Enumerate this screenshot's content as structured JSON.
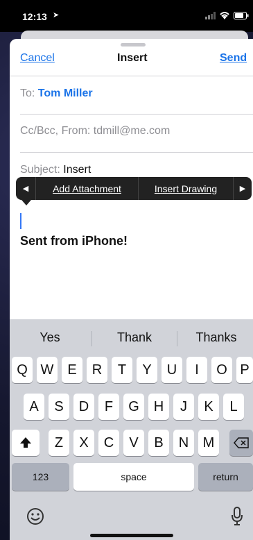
{
  "status_bar": {
    "time": "12:13"
  },
  "nav": {
    "cancel": "Cancel",
    "title": "Insert",
    "send": "Send"
  },
  "fields": {
    "to_label": "To:",
    "to_value": "Tom Miller",
    "cc_label": "Cc/Bcc, From:",
    "from_value": "tdmill@me.com",
    "subject_label": "Subject:",
    "subject_value": "Insert"
  },
  "callout_menu": {
    "items": [
      "Add Attachment",
      "Insert Drawing"
    ],
    "prev_arrow": "◀",
    "next_arrow": "▶"
  },
  "body": {
    "signature": "Sent from iPhone!"
  },
  "keyboard": {
    "suggestions": [
      "Yes",
      "Thank",
      "Thanks"
    ],
    "row1": [
      "Q",
      "W",
      "E",
      "R",
      "T",
      "Y",
      "U",
      "I",
      "O",
      "P"
    ],
    "row2": [
      "A",
      "S",
      "D",
      "F",
      "G",
      "H",
      "J",
      "K",
      "L"
    ],
    "row3": [
      "Z",
      "X",
      "C",
      "V",
      "B",
      "N",
      "M"
    ],
    "numbers_label": "123",
    "space_label": "space",
    "return_label": "return",
    "icons": [
      "shift-icon",
      "delete-icon",
      "emoji-icon",
      "microphone-icon"
    ]
  },
  "colors": {
    "accent": "#1a73e8",
    "callout_bg": "#222222",
    "keyboard_bg": "#d1d3d9"
  }
}
